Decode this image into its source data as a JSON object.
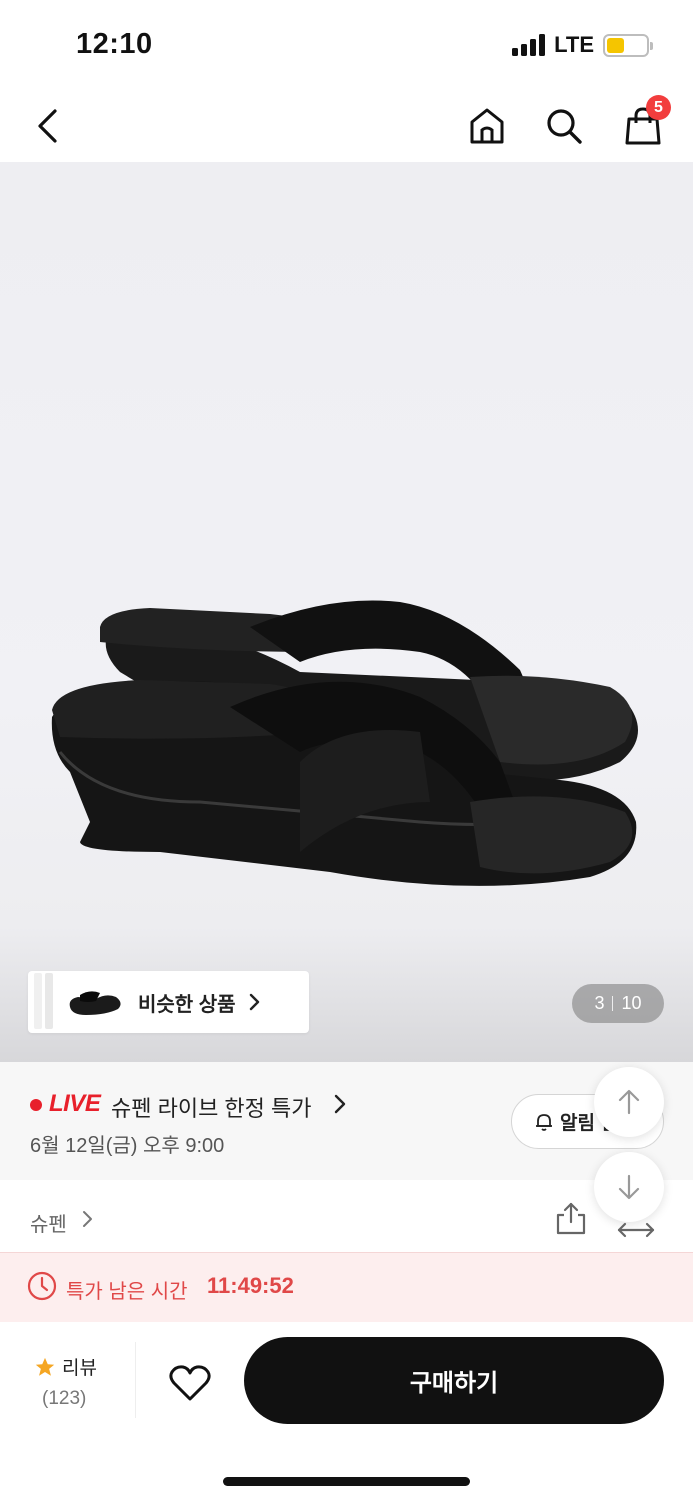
{
  "status_bar": {
    "time": "12:10",
    "network": "LTE",
    "battery_level": 0.45
  },
  "nav": {
    "back_icon": "chevron-left-icon",
    "home_icon": "home-icon",
    "search_icon": "search-icon",
    "cart_icon": "shopping-bag-icon",
    "cart_count": "5"
  },
  "product_image": {
    "similar_label": "비슷한 상품",
    "page_current": "3",
    "page_total": "10"
  },
  "live": {
    "tag": "LIVE",
    "title": "슈펜 라이브 한정 특가",
    "date": "6월 12일(금) 오후 9:00",
    "alarm_label": "알림 신"
  },
  "brand": {
    "name": "슈펜"
  },
  "timer": {
    "label": "특가 남은 시간",
    "value": "11:49:52"
  },
  "bottom": {
    "review_label": "리뷰",
    "review_count": "(123)",
    "buy_label": "구매하기"
  },
  "colors": {
    "accent_red": "#e8202b",
    "timer_red": "#e04848",
    "star": "#f5a623",
    "button_black": "#111111"
  }
}
